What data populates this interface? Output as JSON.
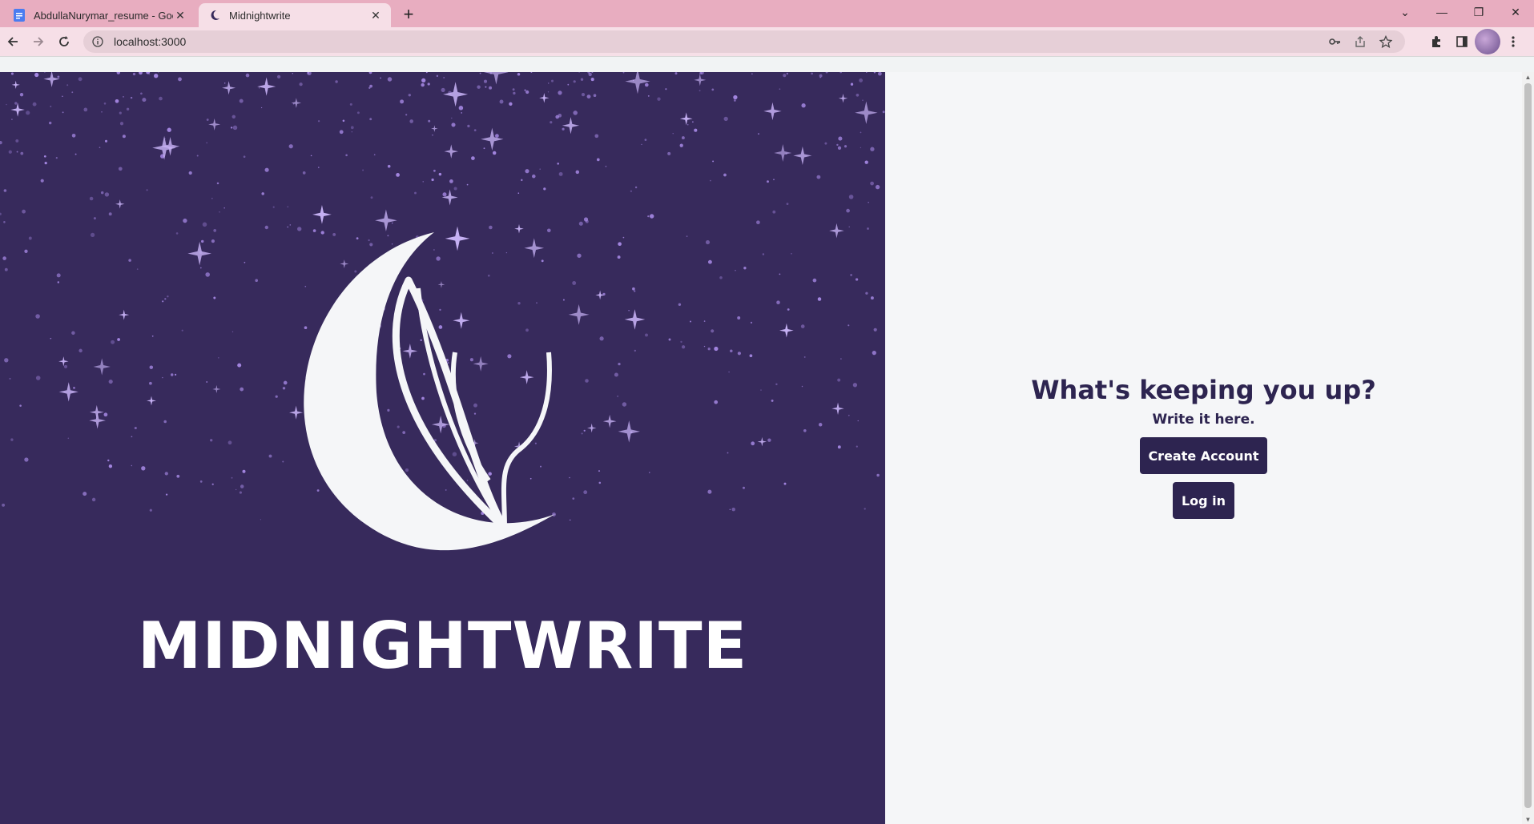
{
  "browser": {
    "tabs": [
      {
        "title": "AbdullaNurymar_resume - Google",
        "icon": "google-docs-icon",
        "active": false
      },
      {
        "title": "Midnightwrite",
        "icon": "moon-quill-icon",
        "active": true
      }
    ],
    "address": "localhost:3000"
  },
  "hero": {
    "brand_name": "MIDNIGHTWRITE"
  },
  "landing": {
    "headline": "What's keeping you up?",
    "subline": "Write it here.",
    "create_account_label": "Create Account",
    "login_label": "Log in"
  },
  "colors": {
    "brand_purple": "#372a5c",
    "text_dark_purple": "#2d2450",
    "star_lavender": "#a98be8",
    "page_bg": "#f5f6f8",
    "tabstrip_pink": "#e8adc0"
  }
}
